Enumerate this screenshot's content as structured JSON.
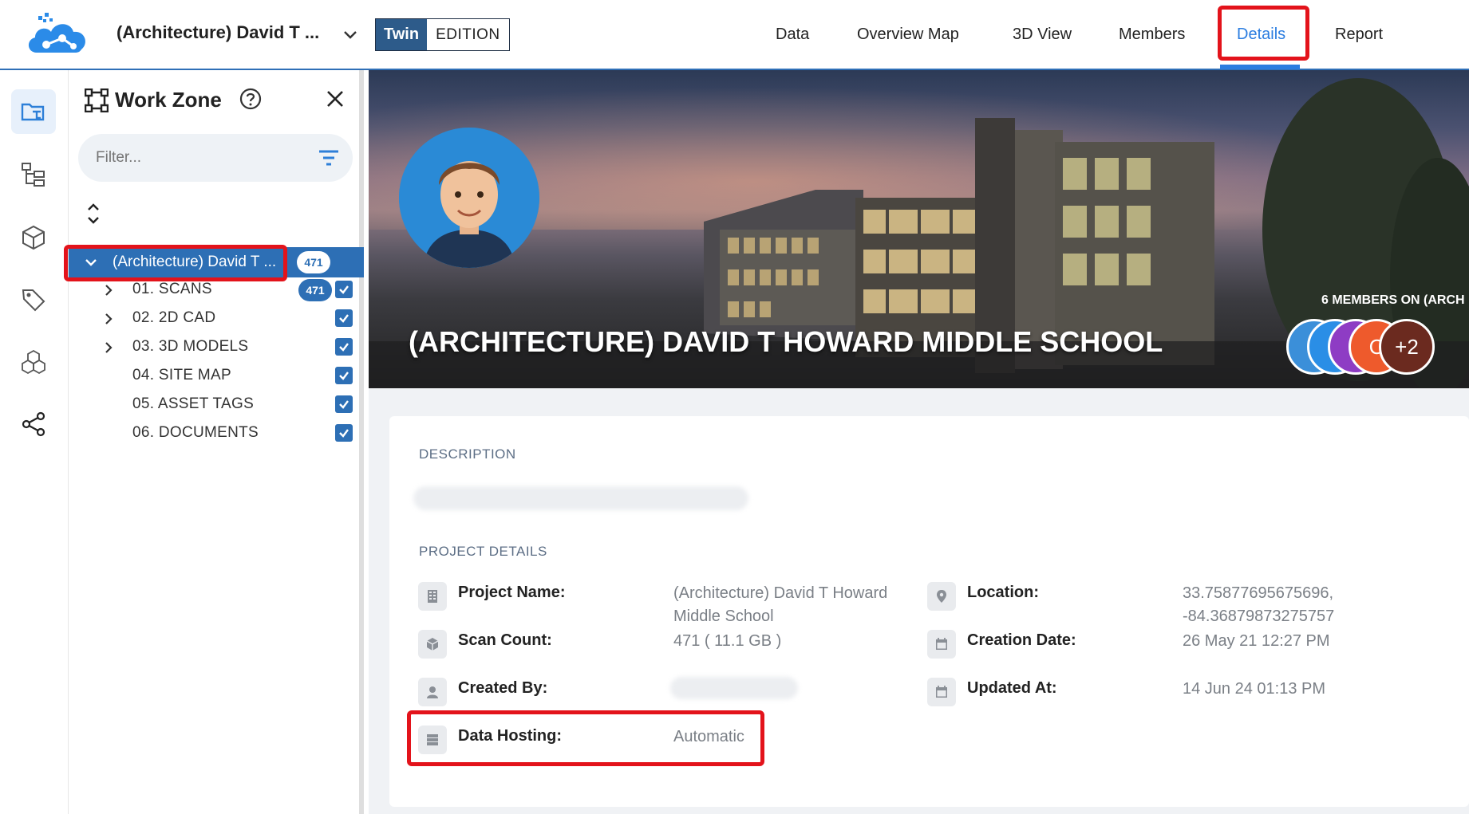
{
  "header": {
    "project_title": "(Architecture) David T ...",
    "edition_twin": "Twin",
    "edition_label": "EDITION",
    "nav": [
      "Data",
      "Overview Map",
      "3D View",
      "Members",
      "Details",
      "Report"
    ],
    "active_nav": "Details",
    "accent_color": "#2b7de0",
    "highlight_color": "#e3131b"
  },
  "rail": {
    "icons": [
      "folder-tree-icon",
      "hierarchy-icon",
      "cube-icon",
      "tag-icon",
      "cubes-icon",
      "share-icon"
    ]
  },
  "workzone": {
    "title": "Work Zone",
    "filter_placeholder": "Filter...",
    "root": {
      "label": "(Architecture) David T ...",
      "count": "471"
    },
    "items": [
      {
        "label": "01. SCANS",
        "count": "471",
        "expandable": true
      },
      {
        "label": "02. 2D CAD",
        "expandable": true
      },
      {
        "label": "03. 3D MODELS",
        "expandable": true
      },
      {
        "label": "04. SITE MAP",
        "expandable": false
      },
      {
        "label": "05. ASSET TAGS",
        "expandable": false
      },
      {
        "label": "06. DOCUMENTS",
        "expandable": false
      }
    ]
  },
  "hero": {
    "title": "(ARCHITECTURE) DAVID T HOWARD MIDDLE SCHOOL",
    "members_title": "6 MEMBERS ON (ARCH",
    "members": [
      {
        "initial": "",
        "color": "#3b8fd9"
      },
      {
        "initial": "C",
        "color": "#2a8ee6"
      },
      {
        "initial": "",
        "color": "#8e3cc4"
      },
      {
        "initial": "C",
        "color": "#ee5a2c"
      },
      {
        "initial": "+2",
        "color": "#6b2a1f"
      }
    ]
  },
  "details": {
    "description_label": "DESCRIPTION",
    "project_details_label": "PROJECT DETAILS",
    "project_name_label": "Project Name:",
    "project_name_value": "(Architecture) David T Howard Middle School",
    "scan_count_label": "Scan Count:",
    "scan_count_value": "471 ( 11.1 GB )",
    "created_by_label": "Created By:",
    "data_hosting_label": "Data Hosting:",
    "data_hosting_value": "Automatic",
    "location_label": "Location:",
    "location_value_1": "33.75877695675696,",
    "location_value_2": "-84.36879873275757",
    "creation_date_label": "Creation Date:",
    "creation_date_value": "26 May 21 12:27 PM",
    "updated_at_label": "Updated At:",
    "updated_at_value": "14 Jun 24 01:13 PM"
  }
}
